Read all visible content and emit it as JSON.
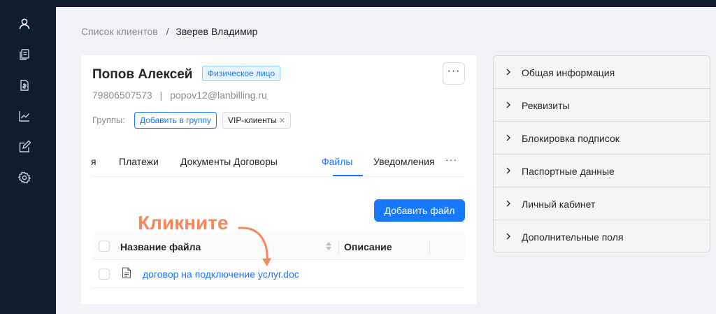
{
  "sidebar": {
    "icons": [
      "user-icon",
      "documents-icon",
      "invoice-icon",
      "chart-icon",
      "edit-icon",
      "settings-icon"
    ]
  },
  "breadcrumb": {
    "parent": "Список клиентов",
    "separator": "/",
    "current": "Зверев Владимир"
  },
  "client": {
    "name": "Попов Алексей",
    "type_badge": "Физическое лицо",
    "more_label": "···",
    "phone": "79806507573",
    "contacts_separator": "|",
    "email": "popov12@lanbilling.ru",
    "groups_label": "Группы:",
    "add_group_label": "Добавить в группу",
    "group_tag": "VIP-клиенты",
    "group_tag_close": "✕"
  },
  "tabs": {
    "items": [
      "я",
      "Платежи",
      "Документы",
      "Договоры",
      "Файлы",
      "Уведомления"
    ],
    "active": "Файлы",
    "more_label": "···"
  },
  "files": {
    "add_button": "Добавить файл",
    "columns": [
      "Название файла",
      "Описание"
    ],
    "rows": [
      {
        "name": "договор на подключение услуг.doc",
        "description": ""
      }
    ]
  },
  "hint": {
    "text": "Кликните",
    "color": "#f4875b"
  },
  "accordion": {
    "items": [
      "Общая информация",
      "Реквизиты",
      "Блокировка подписок",
      "Паспортные данные",
      "Личный кабинет",
      "Дополнительные поля"
    ]
  },
  "colors": {
    "accent": "#1677ff",
    "sidebar": "#0f1d2e",
    "background": "#f0f2f5"
  }
}
